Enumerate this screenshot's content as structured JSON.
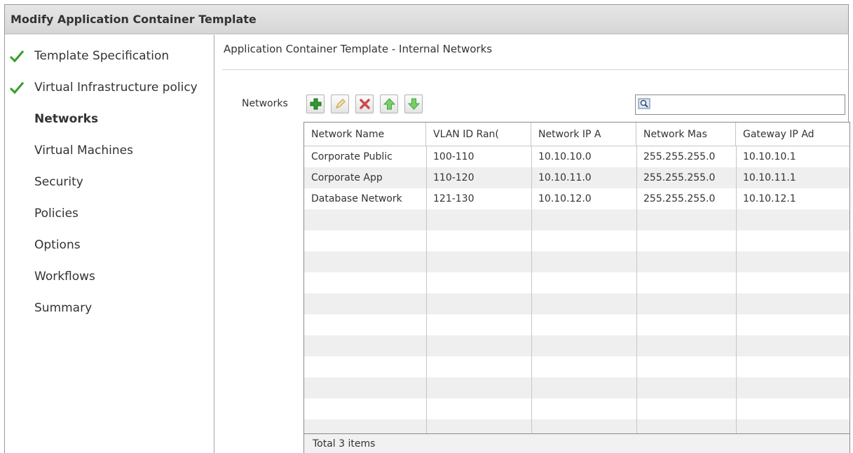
{
  "window": {
    "title": "Modify Application Container Template"
  },
  "sidebar": {
    "steps": [
      {
        "label": "Template Specification",
        "completed": true
      },
      {
        "label": "Virtual Infrastructure policy",
        "completed": true
      },
      {
        "label": "Networks",
        "completed": false,
        "active": true
      },
      {
        "label": "Virtual Machines",
        "completed": false
      },
      {
        "label": "Security",
        "completed": false
      },
      {
        "label": "Policies",
        "completed": false
      },
      {
        "label": "Options",
        "completed": false
      },
      {
        "label": "Workflows",
        "completed": false
      },
      {
        "label": "Summary",
        "completed": false
      }
    ]
  },
  "main": {
    "title": "Application Container Template - Internal Networks",
    "networks_label": "Networks",
    "toolbar": {
      "buttons": [
        "add-icon",
        "edit-icon",
        "delete-icon",
        "move-up-icon",
        "move-down-icon"
      ],
      "search_value": ""
    },
    "table": {
      "columns": [
        "Network Name",
        "VLAN ID Ran(",
        "Network IP A",
        "Network Mas",
        "Gateway IP Ad"
      ],
      "rows": [
        [
          "Corporate Public",
          "100-110",
          "10.10.10.0",
          "255.255.255.0",
          "10.10.10.1"
        ],
        [
          "Corporate App",
          "110-120",
          "10.10.11.0",
          "255.255.255.0",
          "10.10.11.1"
        ],
        [
          "Database Network",
          "121-130",
          "10.10.12.0",
          "255.255.255.0",
          "10.10.12.1"
        ]
      ],
      "footer": "Total 3 items"
    }
  },
  "colors": {
    "check": "#3a9a2e",
    "add": "#2e9a2e",
    "delete": "#d04a4a",
    "arrow": "#3aa83a",
    "row_alt": "#efefef"
  }
}
